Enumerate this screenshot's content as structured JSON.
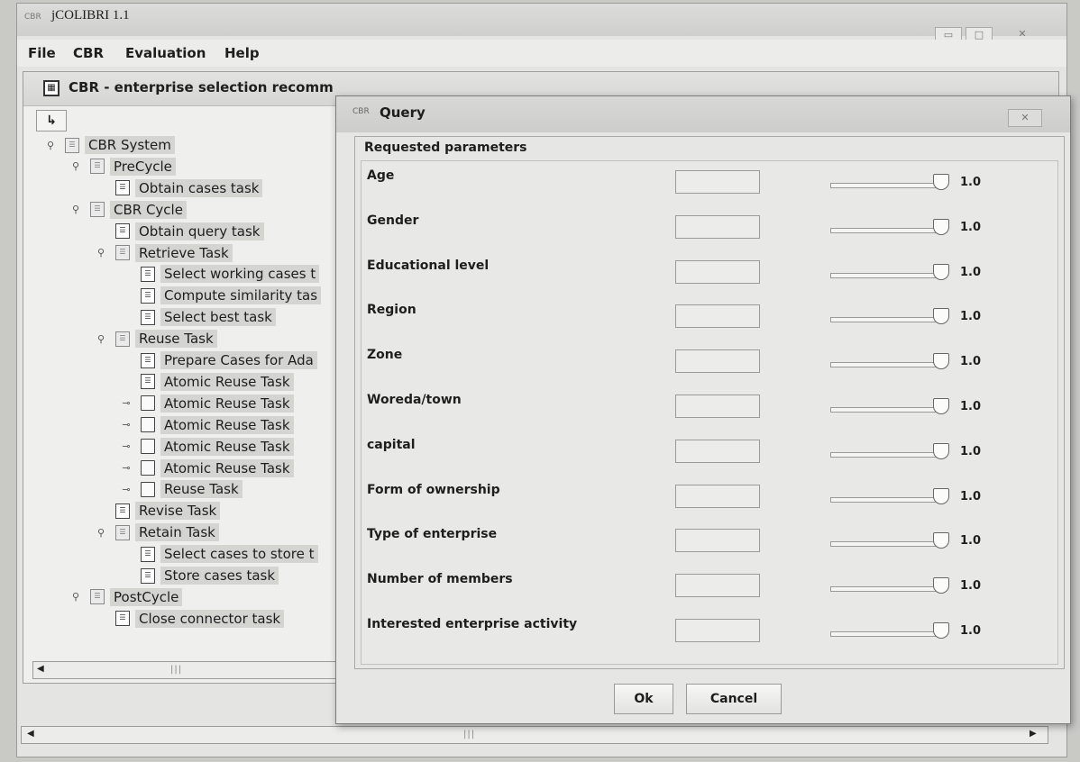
{
  "app": {
    "title": "jCOLIBRI 1.1",
    "icon_text": "CBR"
  },
  "window_controls": [
    "▭",
    "□",
    "✕"
  ],
  "menu": [
    "File",
    "CBR",
    "Evaluation",
    "Help"
  ],
  "inner_frame": {
    "title": "CBR - enterprise selection recomm",
    "toolbar_button": "↳"
  },
  "tree": [
    {
      "label": "CBR System",
      "level": 0,
      "toggle": "⚲",
      "icon": "folder"
    },
    {
      "label": "PreCycle",
      "level": 1,
      "toggle": "⚲",
      "icon": "folder"
    },
    {
      "label": "Obtain cases task",
      "level": 2,
      "toggle": "",
      "icon": "task"
    },
    {
      "label": "CBR Cycle",
      "level": 1,
      "toggle": "⚲",
      "icon": "folder"
    },
    {
      "label": "Obtain query task",
      "level": 2,
      "toggle": "",
      "icon": "task"
    },
    {
      "label": "Retrieve Task",
      "level": 2,
      "toggle": "⚲",
      "icon": "folder"
    },
    {
      "label": "Select working cases t",
      "level": 3,
      "toggle": "",
      "icon": "task"
    },
    {
      "label": "Compute similarity tas",
      "level": 3,
      "toggle": "",
      "icon": "task"
    },
    {
      "label": "Select best task",
      "level": 3,
      "toggle": "",
      "icon": "task"
    },
    {
      "label": "Reuse Task",
      "level": 2,
      "toggle": "⚲",
      "icon": "folder"
    },
    {
      "label": "Prepare Cases for Ada",
      "level": 3,
      "toggle": "",
      "icon": "task"
    },
    {
      "label": "Atomic Reuse Task",
      "level": 3,
      "toggle": "",
      "icon": "task"
    },
    {
      "label": "Atomic Reuse Task",
      "level": 3,
      "toggle": "⊸",
      "icon": "doc"
    },
    {
      "label": "Atomic Reuse Task",
      "level": 3,
      "toggle": "⊸",
      "icon": "doc"
    },
    {
      "label": "Atomic Reuse Task",
      "level": 3,
      "toggle": "⊸",
      "icon": "doc"
    },
    {
      "label": "Atomic Reuse Task",
      "level": 3,
      "toggle": "⊸",
      "icon": "doc"
    },
    {
      "label": "Reuse Task",
      "level": 3,
      "toggle": "⊸",
      "icon": "doc"
    },
    {
      "label": "Revise Task",
      "level": 2,
      "toggle": "",
      "icon": "task"
    },
    {
      "label": "Retain Task",
      "level": 2,
      "toggle": "⚲",
      "icon": "folder"
    },
    {
      "label": "Select cases to store t",
      "level": 3,
      "toggle": "",
      "icon": "task"
    },
    {
      "label": "Store cases task",
      "level": 3,
      "toggle": "",
      "icon": "task"
    },
    {
      "label": "PostCycle",
      "level": 1,
      "toggle": "⚲",
      "icon": "folder"
    },
    {
      "label": "Close connector task",
      "level": 2,
      "toggle": "",
      "icon": "task"
    }
  ],
  "scroll_grip": "|||",
  "scroll_arrows": {
    "left": "◀",
    "right": "▶"
  },
  "dialog": {
    "title": "Query",
    "icon_text": "CBR",
    "close_label": "✕",
    "group_title": "Requested parameters",
    "params": [
      {
        "label": "Age",
        "value": "",
        "weight": "1.0"
      },
      {
        "label": "Gender",
        "value": "",
        "weight": "1.0"
      },
      {
        "label": "Educational level",
        "value": "",
        "weight": "1.0"
      },
      {
        "label": "Region",
        "value": "",
        "weight": "1.0"
      },
      {
        "label": "Zone",
        "value": "",
        "weight": "1.0"
      },
      {
        "label": "Woreda/town",
        "value": "",
        "weight": "1.0"
      },
      {
        "label": "capital",
        "value": "",
        "weight": "1.0"
      },
      {
        "label": "Form of ownership",
        "value": "",
        "weight": "1.0"
      },
      {
        "label": "Type of enterprise",
        "value": "",
        "weight": "1.0"
      },
      {
        "label": "Number of members",
        "value": "",
        "weight": "1.0"
      },
      {
        "label": "Interested enterprise activity",
        "value": "",
        "weight": "1.0"
      }
    ],
    "ok_label": "Ok",
    "cancel_label": "Cancel"
  }
}
